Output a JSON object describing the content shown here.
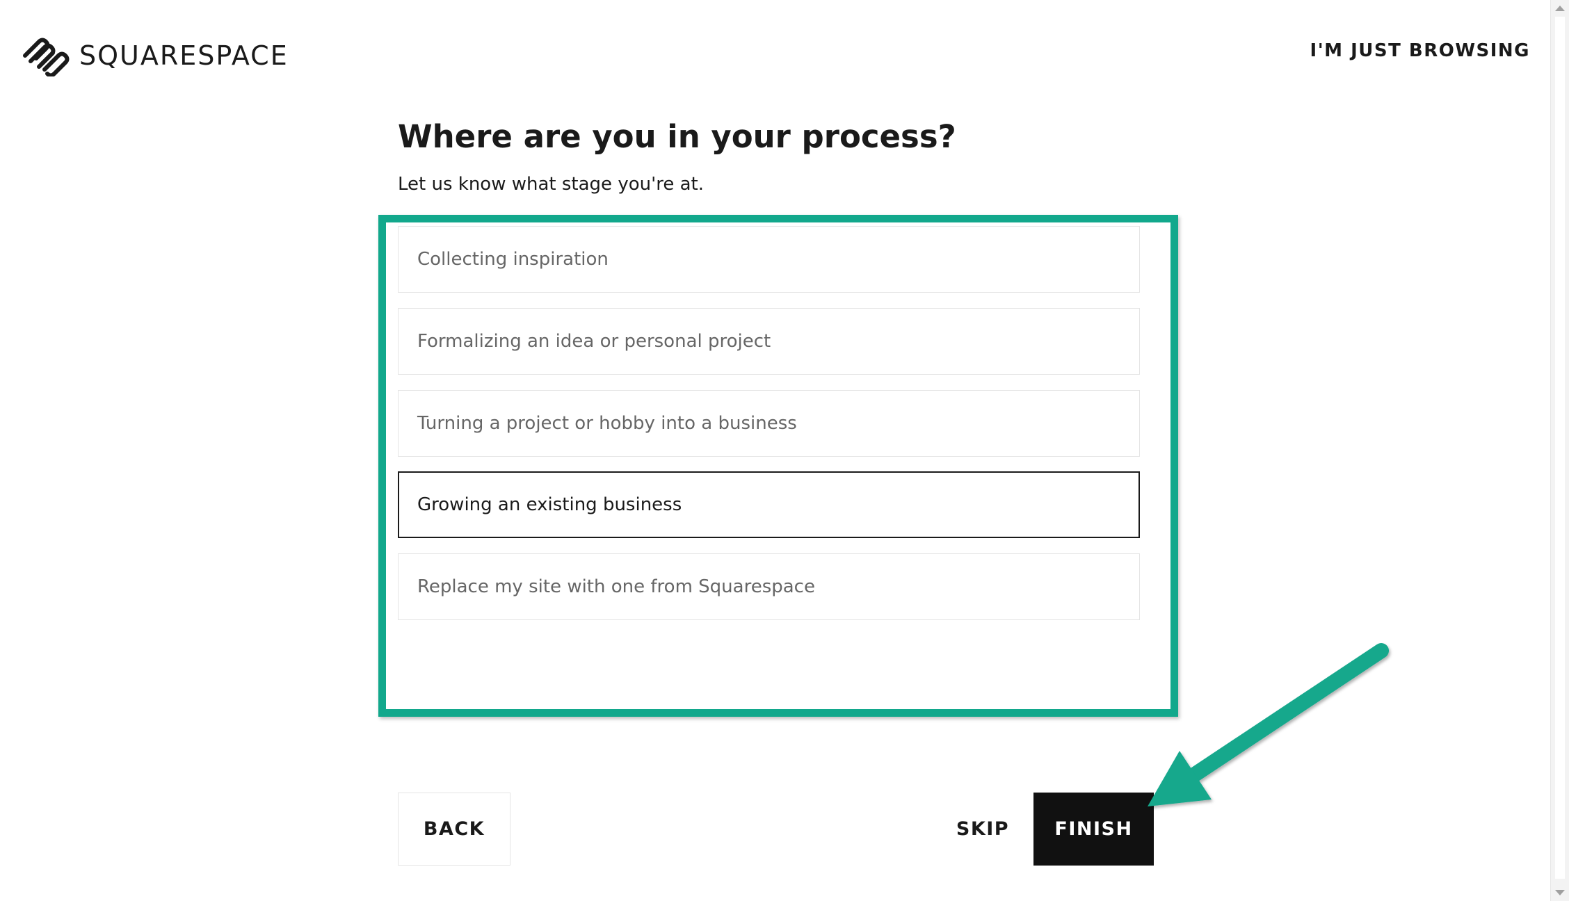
{
  "header": {
    "brand": "SQUARESPACE",
    "browse_link": "I'M JUST BROWSING",
    "logo_icon": "squarespace-logo-icon"
  },
  "main": {
    "title": "Where are you in your process?",
    "subtitle": "Let us know what stage you're at.",
    "options": [
      {
        "label": "Collecting inspiration",
        "selected": false
      },
      {
        "label": "Formalizing an idea or personal project",
        "selected": false
      },
      {
        "label": "Turning a project or hobby into a business",
        "selected": false
      },
      {
        "label": "Growing an existing business",
        "selected": true
      },
      {
        "label": "Replace my site with one from Squarespace",
        "selected": false
      }
    ]
  },
  "footer": {
    "back_label": "BACK",
    "skip_label": "SKIP",
    "finish_label": "FINISH"
  },
  "annotation": {
    "highlight_color": "#12a88c",
    "arrow_color": "#12a88c",
    "arrow_icon": "annotation-arrow-icon"
  }
}
